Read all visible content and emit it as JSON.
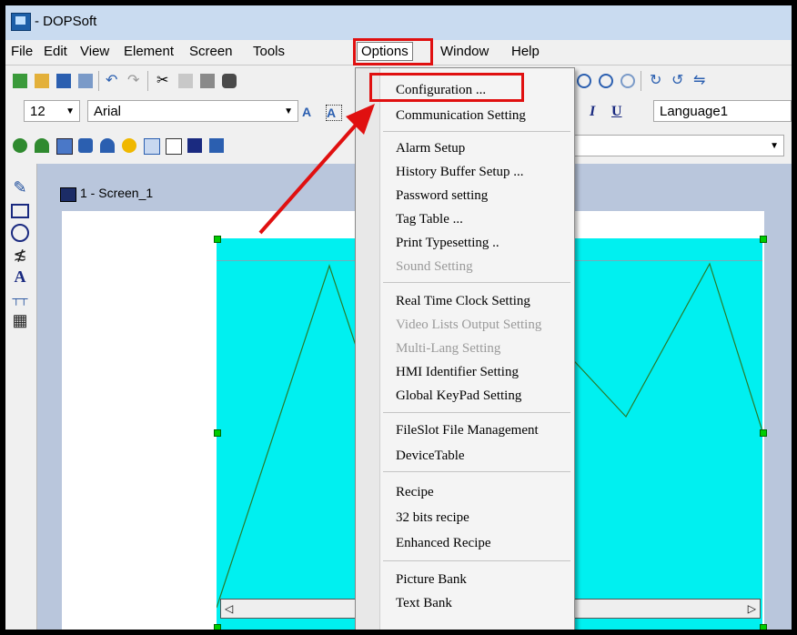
{
  "window": {
    "title": "- DOPSoft"
  },
  "menubar": {
    "items": [
      "File",
      "Edit",
      "View",
      "Element",
      "Screen",
      "Tools",
      "Options",
      "Window",
      "Help"
    ]
  },
  "toolbar": {
    "font_size": "12",
    "font_name": "Arial",
    "language": "Language1"
  },
  "screen": {
    "tab_label": "1 - Screen_1"
  },
  "options_menu": {
    "items": [
      {
        "label": "Configuration ...",
        "enabled": true
      },
      {
        "label": "Communication Setting",
        "enabled": true
      },
      {
        "label": "Alarm Setup",
        "enabled": true
      },
      {
        "label": "History Buffer Setup ...",
        "enabled": true
      },
      {
        "label": "Password setting",
        "enabled": true
      },
      {
        "label": "Tag Table ...",
        "enabled": true
      },
      {
        "label": "Print Typesetting ..",
        "enabled": true
      },
      {
        "label": "Sound Setting",
        "enabled": false
      },
      {
        "label": "Real Time Clock Setting",
        "enabled": true
      },
      {
        "label": "Video Lists Output Setting",
        "enabled": false
      },
      {
        "label": "Multi-Lang Setting",
        "enabled": false
      },
      {
        "label": "HMI Identifier Setting",
        "enabled": true
      },
      {
        "label": "Global KeyPad Setting",
        "enabled": true
      },
      {
        "label": "FileSlot File Management",
        "enabled": true
      },
      {
        "label": "DeviceTable",
        "enabled": true
      },
      {
        "label": "Recipe",
        "enabled": true
      },
      {
        "label": "32 bits recipe",
        "enabled": true
      },
      {
        "label": "Enhanced Recipe",
        "enabled": true
      },
      {
        "label": "Picture Bank",
        "enabled": true
      },
      {
        "label": "Text Bank",
        "enabled": true
      }
    ]
  },
  "icons": {
    "left_tools": [
      "pencil-icon",
      "rectangle-icon",
      "circle-icon",
      "polyline-icon",
      "text-icon",
      "scale-icon",
      "table-icon"
    ]
  },
  "colors": {
    "highlight": "#e01010",
    "trend_bg": "#00f0f0",
    "trend_line": "#2a7a2a"
  }
}
